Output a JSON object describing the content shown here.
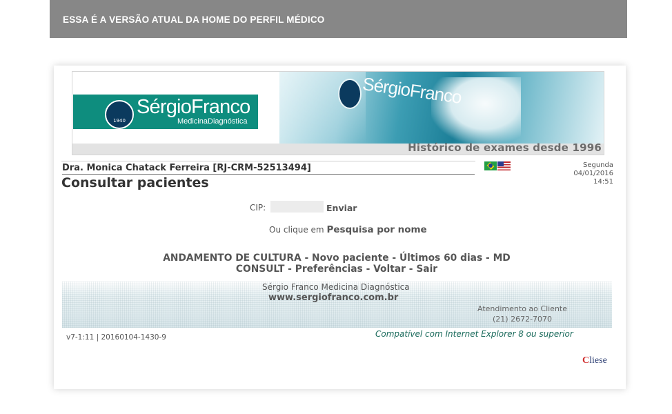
{
  "top_bar": {
    "text": "ESSA É A VERSÃO ATUAL DA HOME DO PERFIL MÉDICO"
  },
  "banner": {
    "logo_name": "SérgioFranco",
    "logo_sub": "MedicinaDiagnóstica",
    "logo_year": "1940",
    "tagline": "Histórico de exames desde 1996"
  },
  "header": {
    "doctor": "Dra. Monica Chatack Ferreira [RJ-CRM-52513494]",
    "date": {
      "weekday": "Segunda",
      "date": "04/01/2016",
      "time": "14:51"
    },
    "languages": [
      "pt-BR",
      "en-US"
    ]
  },
  "page_title": "Consultar pacientes",
  "cip_form": {
    "label": "CIP:",
    "value": "",
    "placeholder": "",
    "send": "Enviar"
  },
  "search": {
    "prefix": "Ou clique em",
    "link": "Pesquisa por nome"
  },
  "menu": {
    "andamento": "ANDAMENTO DE CULTURA",
    "novo": "Novo paciente",
    "ultimos": "Últimos 60 dias",
    "md": "MD",
    "consult": "CONSULT",
    "preferencias": "Preferências",
    "voltar": "Voltar",
    "sair": "Sair",
    "separator": "-"
  },
  "footer": {
    "company": "Sérgio Franco Medicina Diagnóstica",
    "url": "www.sergiofranco.com.br",
    "service_label": "Atendimento ao Cliente",
    "phone": "(21) 2672-7070"
  },
  "version": "v7-1:11 | 20160104-1430-9",
  "compat": "Compatível com Internet Explorer 8 ou superior",
  "vendor": {
    "c": "C",
    "rest": "liese"
  },
  "colors": {
    "top_bar": "#878787",
    "brand_green": "#0e8d7e",
    "text": "#555555",
    "compat_text": "#1b6b5c"
  }
}
